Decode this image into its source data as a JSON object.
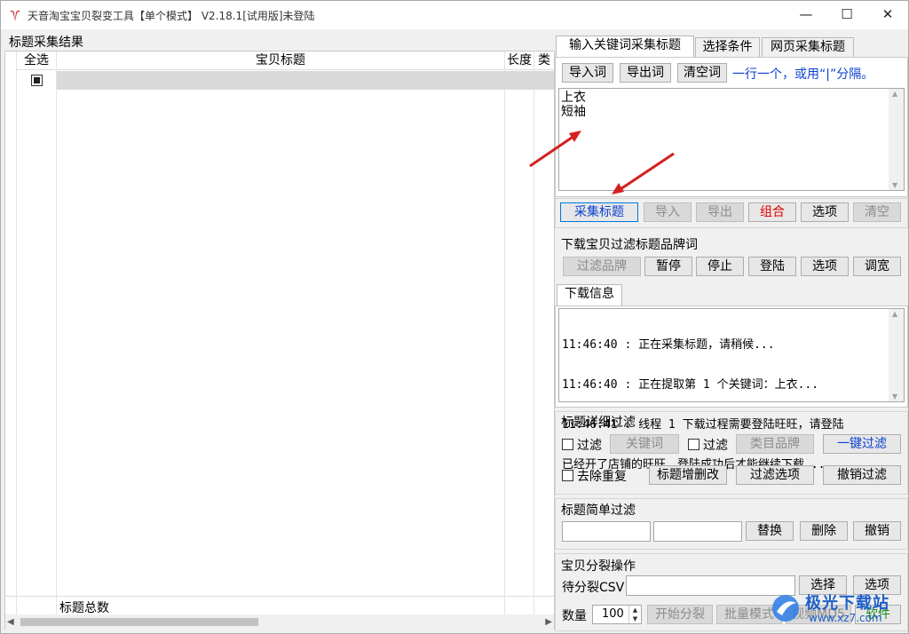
{
  "window": {
    "title": "天音淘宝宝贝裂变工具【单个模式】 V2.18.1[试用版]未登陆",
    "minimize_glyph": "—",
    "maximize_glyph": "☐",
    "close_glyph": "✕"
  },
  "left": {
    "section_title": "标题采集结果",
    "columns": [
      "全选",
      "宝贝标题",
      "长度",
      "类"
    ],
    "footer_label": "标题总数"
  },
  "tabs": [
    "输入关键词采集标题",
    "选择条件",
    "网页采集标题"
  ],
  "keyword_panel": {
    "import_label": "导入词",
    "export_label": "导出词",
    "clear_label": "清空词",
    "hint": "一行一个，或用“|”分隔。",
    "keywords": [
      "上衣",
      "短袖"
    ]
  },
  "collect_row": {
    "collect": "采集标题",
    "import": "导入",
    "export": "导出",
    "combine": "组合",
    "options": "选项",
    "clear": "清空"
  },
  "brand_filter": {
    "title": "下载宝贝过滤标题品牌词",
    "filter_brand": "过滤品牌",
    "pause": "暂停",
    "stop": "停止",
    "login": "登陆",
    "options": "选项",
    "widen": "调宽"
  },
  "download_info": {
    "tab": "下载信息",
    "lines": [
      "11:46:40 : 正在采集标题，请稍候...",
      "11:46:40 : 正在提取第 1 个关键词：上衣...",
      "11:46:41 : 线程 1 下载过程需要登陆旺旺，请登陆",
      "已经开了店铺的旺旺，登陆成功后才能继续下载..."
    ]
  },
  "detail_filter": {
    "title": "标题详细过滤",
    "filter1": "过滤",
    "keywords": "关键词",
    "filter2": "过滤",
    "category_brand": "类目品牌",
    "one_click": "一键过滤",
    "dedupe": "去除重复",
    "title_edit": "标题增删改",
    "filter_options": "过滤选项",
    "undo_filter": "撤销过滤"
  },
  "simple_filter": {
    "title": "标题简单过滤",
    "replace": "替换",
    "delete": "删除",
    "undo": "撤销"
  },
  "split": {
    "title": "宝贝分裂操作",
    "csv_label": "待分裂CSV",
    "select": "选择",
    "options": "选项",
    "count_label": "数量",
    "count_value": "100",
    "start_split": "开始分裂",
    "batch_mode": "批量模式",
    "video_md5": "视频MD5",
    "software": "软件"
  },
  "watermark": {
    "brand": "极光下载站",
    "url": "www.xz7.com"
  },
  "colors": {
    "accent_blue": "#0a3fd0",
    "red_button": "#e00000",
    "arrow_red": "#d42020"
  }
}
